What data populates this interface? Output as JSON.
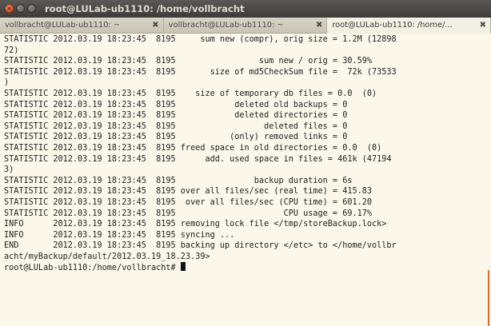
{
  "window": {
    "title": "root@LULab-ub1110: /home/vollbracht"
  },
  "tabs": [
    {
      "label": "vollbracht@LULab-ub1110: ~",
      "close": "✖"
    },
    {
      "label": "vollbracht@LULab-ub1110: ~",
      "close": "✖"
    },
    {
      "label": "root@LULab-ub1110: /home/...",
      "close": "✖"
    }
  ],
  "terminal": {
    "lines": [
      "STATISTIC 2012.03.19 18:23:45  8195     sum new (compr), orig size = 1.2M (12898",
      "72)",
      "STATISTIC 2012.03.19 18:23:45  8195                 sum new / orig = 30.59%",
      "STATISTIC 2012.03.19 18:23:45  8195       size of md5CheckSum file =  72k (73533",
      ")",
      "STATISTIC 2012.03.19 18:23:45  8195    size of temporary db files = 0.0  (0)",
      "STATISTIC 2012.03.19 18:23:45  8195            deleted old backups = 0",
      "STATISTIC 2012.03.19 18:23:45  8195            deleted directories = 0",
      "STATISTIC 2012.03.19 18:23:45  8195                  deleted files = 0",
      "STATISTIC 2012.03.19 18:23:45  8195           (only) removed links = 0",
      "STATISTIC 2012.03.19 18:23:45  8195 freed space in old directories = 0.0  (0)",
      "STATISTIC 2012.03.19 18:23:45  8195      add. used space in files = 461k (47194",
      "3)",
      "STATISTIC 2012.03.19 18:23:45  8195                backup duration = 6s",
      "STATISTIC 2012.03.19 18:23:45  8195 over all files/sec (real time) = 415.83",
      "STATISTIC 2012.03.19 18:23:45  8195  over all files/sec (CPU time) = 601.20",
      "STATISTIC 2012.03.19 18:23:45  8195                      CPU usage = 69.17%",
      "INFO      2012.03.19 18:23:45  8195 removing lock file </tmp/storeBackup.lock>",
      "INFO      2012.03.19 18:23:45  8195 syncing ...",
      "END       2012.03.19 18:23:45  8195 backing up directory </etc> to </home/vollbr",
      "acht/myBackup/default/2012.03.19_18.23.39>"
    ],
    "prompt": "root@LULab-ub1110:/home/vollbracht# "
  },
  "colors": {
    "terminal_background": "#fbf8e9",
    "terminal_text": "#1e1e1c",
    "titlebar": "#3c3b37",
    "close_button": "#d94a1e",
    "scroll_indicator": "#d96a2c"
  },
  "icons": {
    "close": "close-icon",
    "minimize": "minimize-icon",
    "maximize": "maximize-icon",
    "tab_close": "tab-close-icon"
  }
}
